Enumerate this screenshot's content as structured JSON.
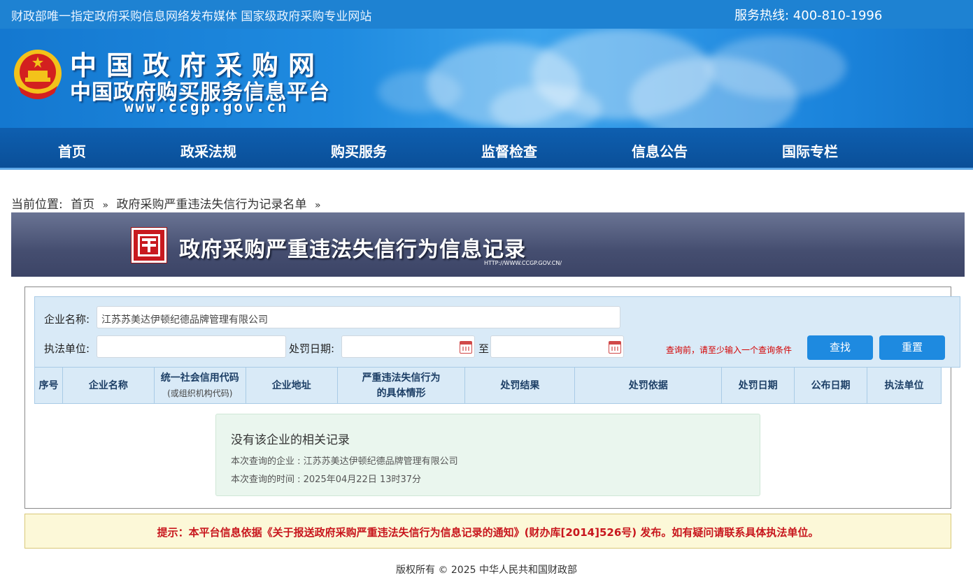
{
  "topbar": {
    "slogan": "财政部唯一指定政府采购信息网络发布媒体 国家级政府采购专业网站",
    "hotline": "服务热线:  400-810-1996"
  },
  "banner": {
    "line1": "中国政府采购网",
    "line2": "中国政府购买服务信息平台",
    "line3": "www.ccgp.gov.cn"
  },
  "nav": {
    "items": [
      "首页",
      "政采法规",
      "购买服务",
      "监督检查",
      "信息公告",
      "国际专栏"
    ]
  },
  "breadcrumb": {
    "prefix": "当前位置:",
    "home": "首页",
    "current": "政府采购严重违法失信行为记录名单",
    "sep": "»"
  },
  "titleband": {
    "title": "政府采购严重违法失信行为信息记录",
    "url": "HTTP://WWW.CCGP.GOV.CN/"
  },
  "search": {
    "company_label": "企业名称:",
    "company_value": "江苏苏美达伊顿纪德品牌管理有限公司",
    "unit_label": "执法单位:",
    "unit_value": "",
    "date_label": "处罚日期:",
    "date_to": "至",
    "date_from_value": "",
    "date_to_value": "",
    "hint": "查询前，请至少输入一个查询条件",
    "find_label": "查找",
    "reset_label": "重置"
  },
  "table": {
    "headers": {
      "seq": "序号",
      "company": "企业名称",
      "credit_code": "统一社会信用代码",
      "credit_code_sub": "(或组织机构代码)",
      "address": "企业地址",
      "situation_1": "严重违法失信行为",
      "situation_2": "的具体情形",
      "result": "处罚结果",
      "basis": "处罚依据",
      "punish_date": "处罚日期",
      "publish_date": "公布日期",
      "unit": "执法单位"
    }
  },
  "result": {
    "title": "没有该企业的相关记录",
    "company_line": "本次查询的企业 : 江苏苏美达伊顿纪德品牌管理有限公司",
    "time_line": "本次查询的时间 : 2025年04月22日 13时37分"
  },
  "notice": {
    "text": "提示：本平台信息依据《关于报送政府采购严重违法失信行为信息记录的通知》(财办库[2014]526号) 发布。如有疑问请联系具体执法单位。"
  },
  "footer": {
    "text": "版权所有 © 2025 中华人民共和国财政部"
  },
  "colors": {
    "topbar": "#1e82d2",
    "nav": "#0e5fb0",
    "button": "#1e8ae0",
    "hint": "#d40000",
    "notice_text": "#c8161d"
  }
}
